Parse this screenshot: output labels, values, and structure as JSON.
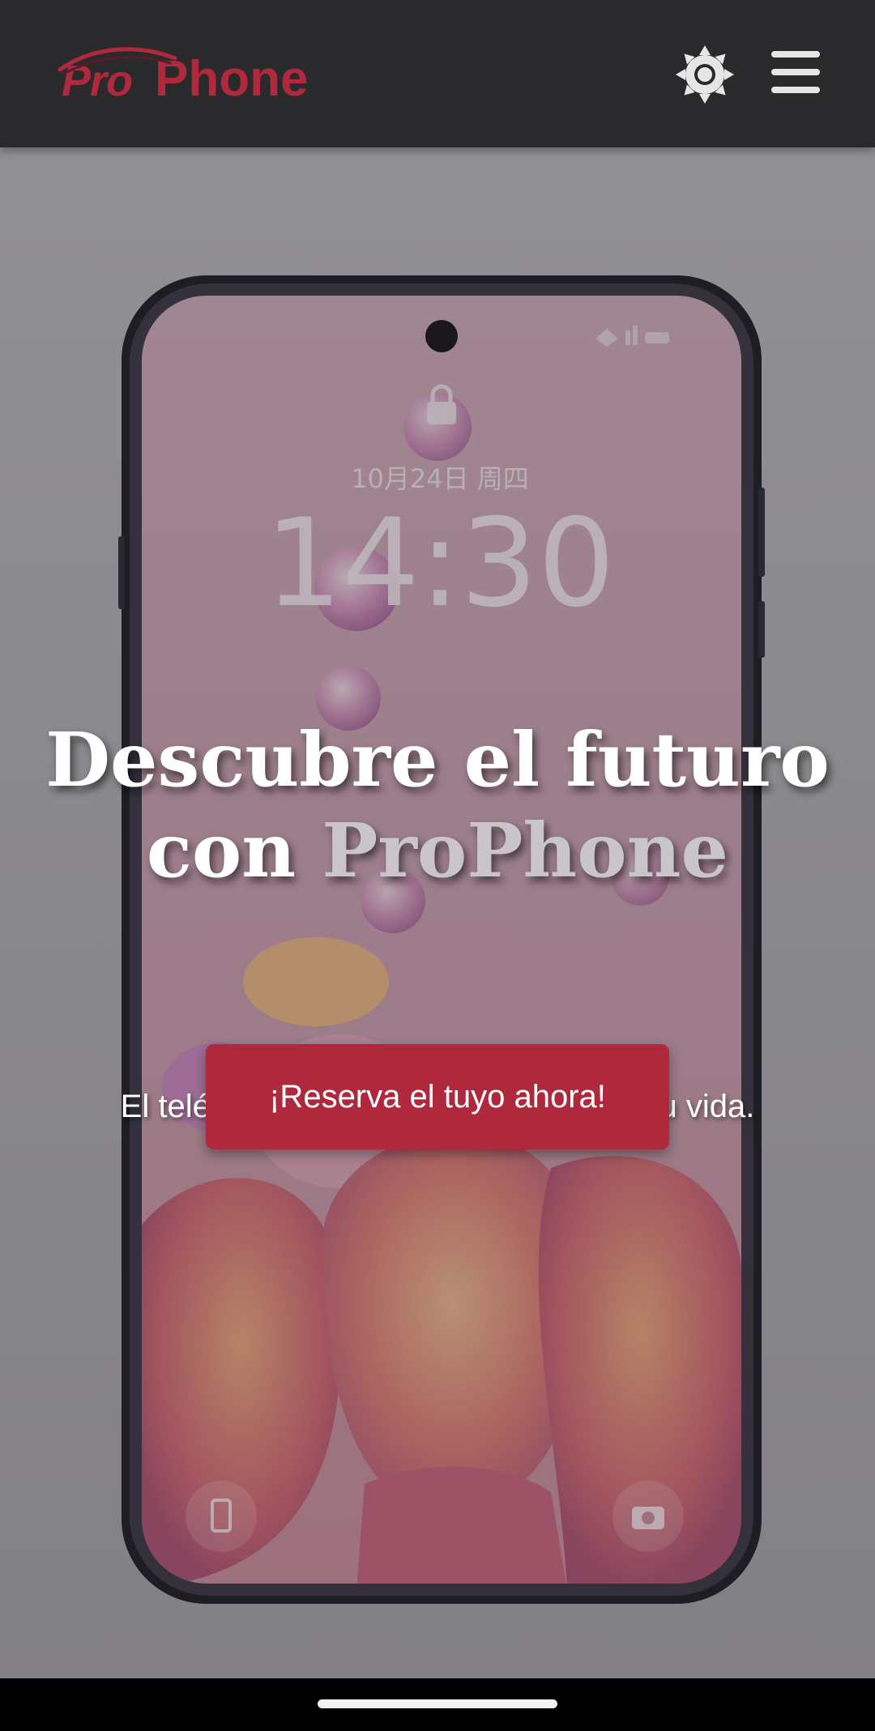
{
  "header": {
    "logo_pro": "Pro",
    "logo_phone": "Phone",
    "theme_icon": "sun-icon",
    "menu_icon": "hamburger-menu-icon"
  },
  "hero": {
    "phone_screen": {
      "date": "10月24日 周四",
      "time": "14:30"
    },
    "title_line1": "Descubre el futuro",
    "title_con": "con",
    "title_brand": "ProPhone",
    "subtitle": "El teléfono diseñado para simplificar tu vida.",
    "cta_label": "¡Reserva el tuyo ahora!"
  },
  "colors": {
    "brand": "#b0283c",
    "header_bg": "#2a2a2c",
    "hero_bg": "#a7a6a9",
    "accent_text": "#c9c5c8"
  }
}
